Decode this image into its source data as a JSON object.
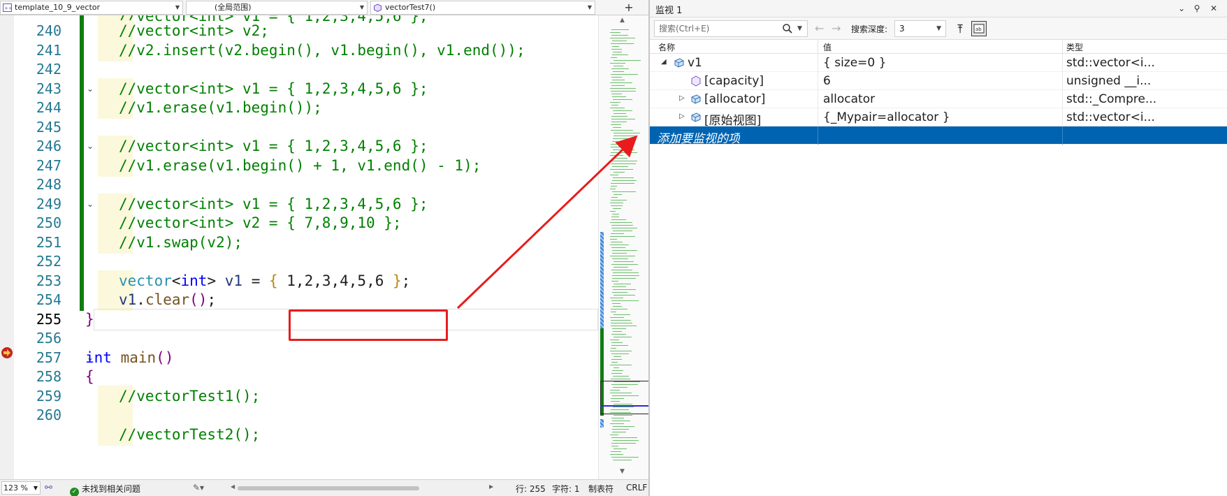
{
  "editor": {
    "nav": {
      "project": "template_10_9_vector",
      "scope": "(全局范围)",
      "member": "vectorTest7()"
    },
    "lines": [
      {
        "num": "240",
        "text": "//vector<int> v2;",
        "kind": "comment",
        "change": true,
        "indent": true
      },
      {
        "num": "241",
        "text": "//v2.insert(v2.begin(), v1.begin(), v1.end());",
        "kind": "comment",
        "change": true,
        "indent": true
      },
      {
        "num": "242",
        "text": "",
        "kind": "blank",
        "change": true,
        "indent": false
      },
      {
        "num": "243",
        "text": "//vector<int> v1 = { 1,2,3,4,5,6 };",
        "kind": "comment",
        "change": true,
        "indent": true,
        "fold": true
      },
      {
        "num": "244",
        "text": "//v1.erase(v1.begin());",
        "kind": "comment",
        "change": true,
        "indent": true
      },
      {
        "num": "245",
        "text": "",
        "kind": "blank",
        "change": true,
        "indent": false
      },
      {
        "num": "246",
        "text": "//vector<int> v1 = { 1,2,3,4,5,6 };",
        "kind": "comment",
        "change": true,
        "indent": true,
        "fold": true
      },
      {
        "num": "247",
        "text": "//v1.erase(v1.begin() + 1, v1.end() - 1);",
        "kind": "comment",
        "change": true,
        "indent": true
      },
      {
        "num": "248",
        "text": "",
        "kind": "blank",
        "change": true,
        "indent": false
      },
      {
        "num": "249",
        "text": "//vector<int> v1 = { 1,2,3,4,5,6 };",
        "kind": "comment",
        "change": true,
        "indent": true,
        "fold": true
      },
      {
        "num": "250",
        "text": "//vector<int> v2 = { 7,8,9,10 };",
        "kind": "comment",
        "change": true,
        "indent": true
      },
      {
        "num": "251",
        "text": "//v1.swap(v2);",
        "kind": "comment",
        "change": true,
        "indent": true
      },
      {
        "num": "252",
        "text": "",
        "kind": "blank",
        "change": true,
        "indent": false
      },
      {
        "num": "253",
        "text": "vector<int> v1 = { 1,2,3,4,5,6 };",
        "kind": "code253",
        "change": true,
        "indent": true
      },
      {
        "num": "254",
        "text": "v1.clear();",
        "kind": "code254",
        "change": true,
        "indent": true
      },
      {
        "num": "255",
        "text": "}",
        "kind": "close",
        "change": false,
        "indent": false,
        "current": true
      },
      {
        "num": "256",
        "text": "",
        "kind": "blank",
        "change": false,
        "indent": false
      },
      {
        "num": "257",
        "text": "int main()",
        "kind": "main",
        "change": false,
        "indent": false,
        "fold": true
      },
      {
        "num": "258",
        "text": "{",
        "kind": "open",
        "change": false,
        "indent": false
      },
      {
        "num": "259",
        "text": "//vectorTest1();",
        "kind": "comment",
        "change": false,
        "indent": true
      },
      {
        "num": "260",
        "text": "",
        "kind": "blank",
        "change": false,
        "indent": true
      }
    ],
    "partial_top": "//vector<int> v1 = { 1,2,3,4,5,6 };",
    "partial_bottom": "//vectorTest2();"
  },
  "status": {
    "zoom": "123 %",
    "issues": "未找到相关问题",
    "line": "行: 255",
    "char": "字符: 1",
    "tabs": "制表符",
    "eol": "CRLF"
  },
  "watch": {
    "title": "监视 1",
    "search_placeholder": "搜索(Ctrl+E)",
    "depth_label": "搜索深度:",
    "depth_value": "3",
    "columns": {
      "name": "名称",
      "value": "值",
      "type": "类型"
    },
    "rows": [
      {
        "name": "v1",
        "value": "{ size=0 }",
        "type": "std::vector<i...",
        "level": 0,
        "expander": "◢"
      },
      {
        "name": "[capacity]",
        "value": "6",
        "type": "unsigned __i...",
        "level": 1,
        "expander": ""
      },
      {
        "name": "[allocator]",
        "value": "allocator",
        "type": "std::_Compre...",
        "level": 1,
        "expander": "▷"
      },
      {
        "name": "[原始视图]",
        "value": "{_Mypair=allocator }",
        "type": "std::vector<i...",
        "level": 1,
        "expander": "▷"
      }
    ],
    "add_item": "添加要监视的项"
  },
  "colors": {
    "accent": "#0063b1",
    "annotation": "#e81c1c",
    "change_bar": "#107c10",
    "comment": "#008000"
  }
}
